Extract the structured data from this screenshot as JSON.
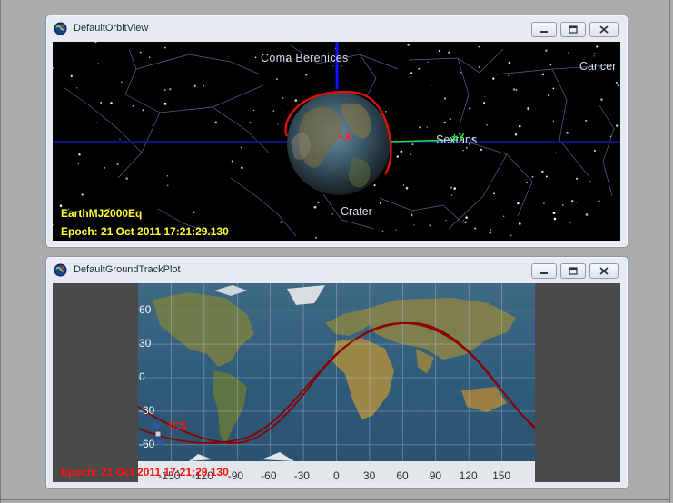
{
  "orbit_window": {
    "title": "DefaultOrbitView",
    "app_icon": "globe-app-icon",
    "coordinate_system": "EarthMJ2000Eq",
    "epoch": "Epoch: 21 Oct 2011 17:21:29.130",
    "constellations": [
      "Coma Berenices",
      "Cancer",
      "Sextans",
      "Crater"
    ],
    "axis_x": "+X",
    "axis_y": "+Y",
    "colors": {
      "background": "#000000",
      "overlay_text": "#ffff33",
      "x_axis": "#ff2020",
      "y_axis": "#20ff40",
      "z_axis": "#1010ff",
      "orbit": "#e01010",
      "constellation_lines": "#6b7fa8"
    }
  },
  "groundtrack_window": {
    "title": "DefaultGroundTrackPlot",
    "app_icon": "globe-app-icon",
    "lat_ticks": [
      "60",
      "30",
      "0",
      "-30",
      "-60"
    ],
    "lon_ticks": [
      "-150",
      "-120",
      "-90",
      "-60",
      "-30",
      "0",
      "30",
      "60",
      "90",
      "120",
      "150"
    ],
    "spacecraft_label": "ICS",
    "epoch": "Epoch: 21 Oct 2011 17:21:29.130",
    "colors": {
      "track": "#8b0000",
      "epoch_text": "#ff1010",
      "grid": "#c8d4e0"
    }
  },
  "window_controls": {
    "minimize": "minimize-icon",
    "maximize": "maximize-icon",
    "close": "close-icon"
  }
}
